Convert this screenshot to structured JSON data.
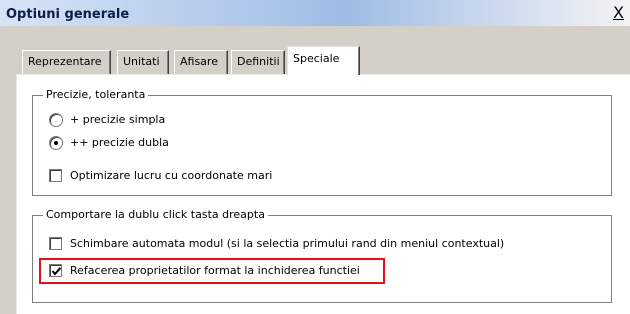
{
  "window": {
    "title": "Optiuni generale",
    "close_symbol": "X"
  },
  "tabs": [
    {
      "label": "Reprezentare",
      "active": false
    },
    {
      "label": "Unitati",
      "active": false
    },
    {
      "label": "Afisare",
      "active": false
    },
    {
      "label": "Definitii",
      "active": false
    },
    {
      "label": "Speciale",
      "active": true
    }
  ],
  "precision_group": {
    "legend": "Precizie, toleranta",
    "options": [
      {
        "label": "+ precizie simpla",
        "selected": false
      },
      {
        "label": "++ precizie dubla",
        "selected": true
      }
    ],
    "optimize": {
      "label": "Optimizare lucru cu coordonate mari",
      "checked": false
    }
  },
  "doubleclick_group": {
    "legend": "Comportare la dublu click tasta dreapta",
    "options": [
      {
        "label": "Schimbare automata modul (si la selectia primului rand din meniul contextual)",
        "checked": false
      },
      {
        "label": "Refacerea proprietatilor format la inchiderea functiei",
        "checked": true
      }
    ]
  },
  "colors": {
    "highlight": "#e3101c",
    "window_bg": "#d4d0c8"
  }
}
